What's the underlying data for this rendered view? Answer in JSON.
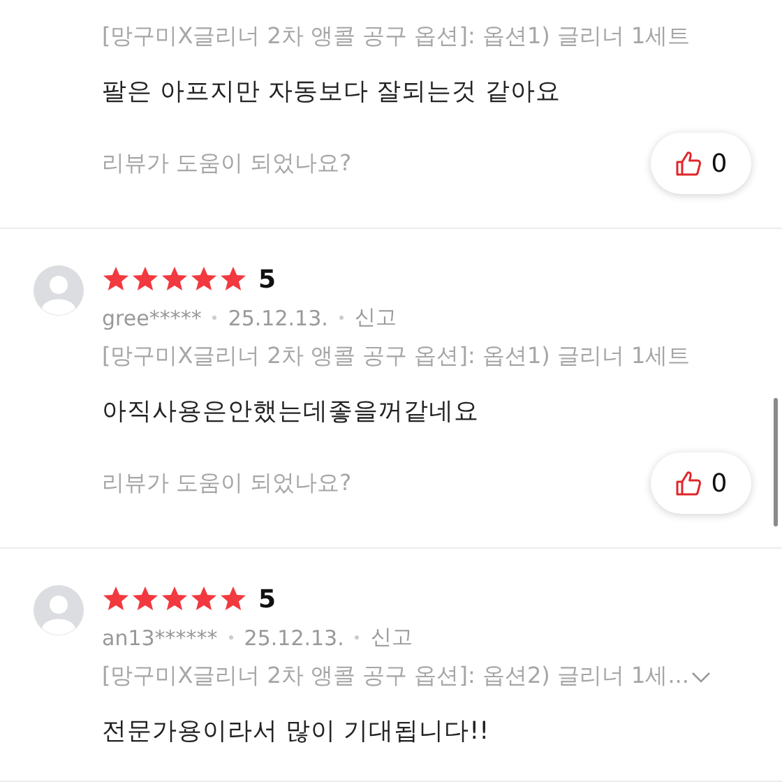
{
  "reviews": [
    {
      "option": "[망구미X글리너 2차 앵콜 공구 옵션]: 옵션1) 글리너 1세트",
      "text": "팔은 아프지만 자동보다 잘되는것 같아요",
      "helpful_prompt": "리뷰가 도움이 되었나요?",
      "likes": "0"
    },
    {
      "stars": 5,
      "rating": "5",
      "user": "gree*****",
      "date": "25.12.13.",
      "report": "신고",
      "option": "[망구미X글리너 2차 앵콜 공구 옵션]: 옵션1) 글리너 1세트",
      "text": "아직사용은안했는데좋을꺼같네요",
      "helpful_prompt": "리뷰가 도움이 되었나요?",
      "likes": "0"
    },
    {
      "stars": 5,
      "rating": "5",
      "user": "an13******",
      "date": "25.12.13.",
      "report": "신고",
      "option": "[망구미X글리너 2차 앵콜 공구 옵션]: 옵션2) 글리너 1세...",
      "expanded": false,
      "text": "전문가용이라서 많이 기대됩니다!!"
    }
  ]
}
